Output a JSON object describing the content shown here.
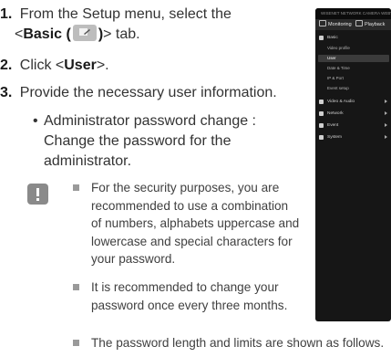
{
  "steps": [
    {
      "num": "1.",
      "text1": "From the Setup menu, select the",
      "text2_prefix": "<",
      "text2_bold": "Basic (",
      "text2_bold_end": ")",
      "text2_suffix": "> tab."
    },
    {
      "num": "2.",
      "prefix": "Click <",
      "bold": "User",
      "suffix": ">."
    },
    {
      "num": "3.",
      "text": "Provide the necessary user information."
    }
  ],
  "sub_bullet": {
    "lines": [
      "Administrator password change :",
      "Change the password for the",
      "administrator."
    ]
  },
  "notes": [
    {
      "lines": [
        "For the security purposes, you are",
        "recommended to use a combination",
        "of numbers, alphabets uppercase and",
        "lowercase and special characters for",
        "your password."
      ]
    },
    {
      "lines": [
        "It is recommended to change your",
        "password once every three months."
      ]
    },
    {
      "lines": [
        "The password length and limits are shown as follows."
      ]
    }
  ],
  "device": {
    "title": "WISENET NETWORK CAMERA WEBVIEWER",
    "tabs": [
      "Monitoring",
      "Playback"
    ],
    "menu": [
      {
        "label": "Basic",
        "expanded": true
      },
      {
        "label": "Video & Audio"
      },
      {
        "label": "Network"
      },
      {
        "label": "Event"
      },
      {
        "label": "System"
      }
    ],
    "basic_items": [
      "Video profile",
      "User",
      "Date & Time",
      "IP & Port",
      "Event setup"
    ],
    "selected_item": "User"
  }
}
